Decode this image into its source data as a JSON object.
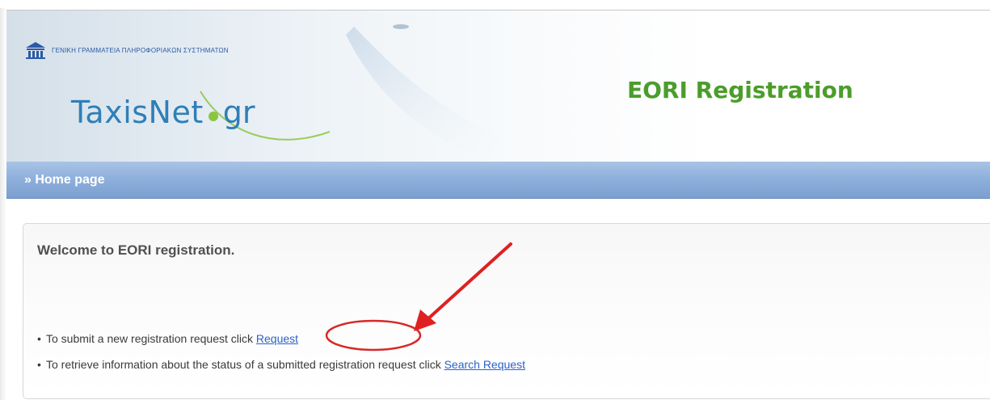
{
  "header": {
    "agency_text": "ΓΕΝΙΚΗ ΓΡΑΜΜΑΤΕΙΑ ΠΛΗΡΟΦΟΡΙΑΚΩΝ ΣΥΣΤΗΜΑΤΩΝ",
    "logo_word": "TaxisNet",
    "logo_suffix": "gr",
    "title": "EORI Registration"
  },
  "nav": {
    "home_label": "» Home page"
  },
  "content": {
    "welcome": "Welcome to EORI registration.",
    "line1_text": "To submit a new registration request click ",
    "line1_link": "Request",
    "line2_text": "To retrieve information about the status of a submitted registration request click ",
    "line2_link": "Search Request"
  },
  "colors": {
    "title_green": "#4b9d2b",
    "nav_blue": "#8fb0dc",
    "link_blue": "#2a63c9",
    "annotation_red": "#e02020"
  }
}
